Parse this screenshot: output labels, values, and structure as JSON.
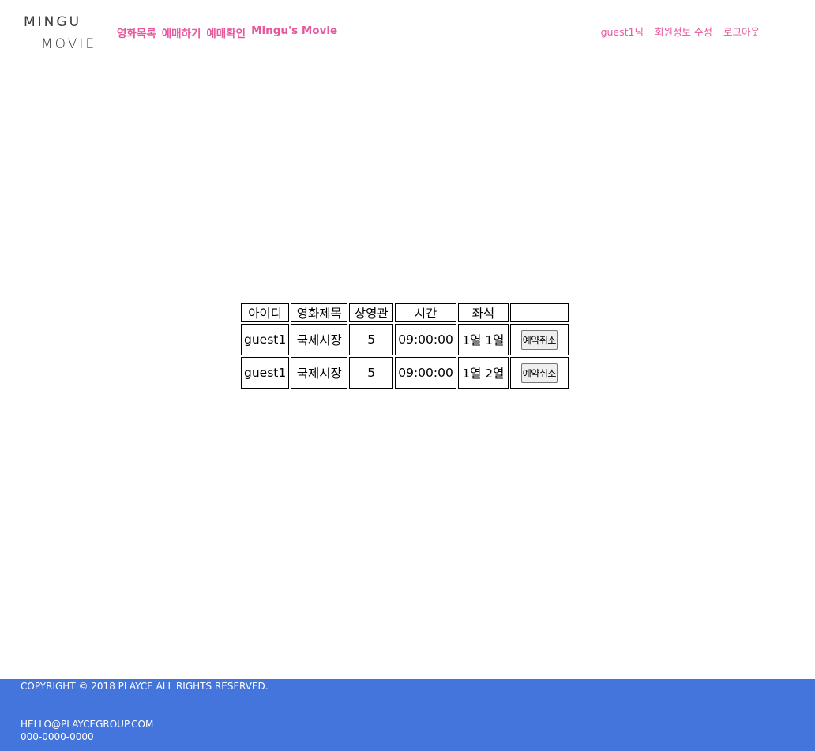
{
  "header": {
    "logo": {
      "line1": "MINGU",
      "line2": "MOVIE"
    },
    "nav": [
      {
        "label": "영화목록"
      },
      {
        "label": "예매하기"
      },
      {
        "label": "예매확인"
      },
      {
        "label": "Mingu's Movie"
      }
    ],
    "user_greeting": "guest1님",
    "edit_profile": "회원정보 수정",
    "logout": "로그아웃"
  },
  "table": {
    "headers": [
      "아이디",
      "영화제목",
      "상영관",
      "시간",
      "좌석",
      ""
    ],
    "rows": [
      {
        "id": "guest1",
        "title": "국제시장",
        "hall": "5",
        "time": "09:00:00",
        "seat": "1열 1열",
        "action": "예약취소"
      },
      {
        "id": "guest1",
        "title": "국제시장",
        "hall": "5",
        "time": "09:00:00",
        "seat": "1열 2열",
        "action": "예약취소"
      }
    ]
  },
  "footer": {
    "copyright": "COPYRIGHT © 2018 PLAYCE ALL RIGHTS RESERVED.",
    "email": "HELLO@PLAYCEGROUP.COM",
    "phone": "000-0000-0000"
  },
  "colors": {
    "accent": "#e8579c",
    "footer_bg": "#4475dc"
  }
}
